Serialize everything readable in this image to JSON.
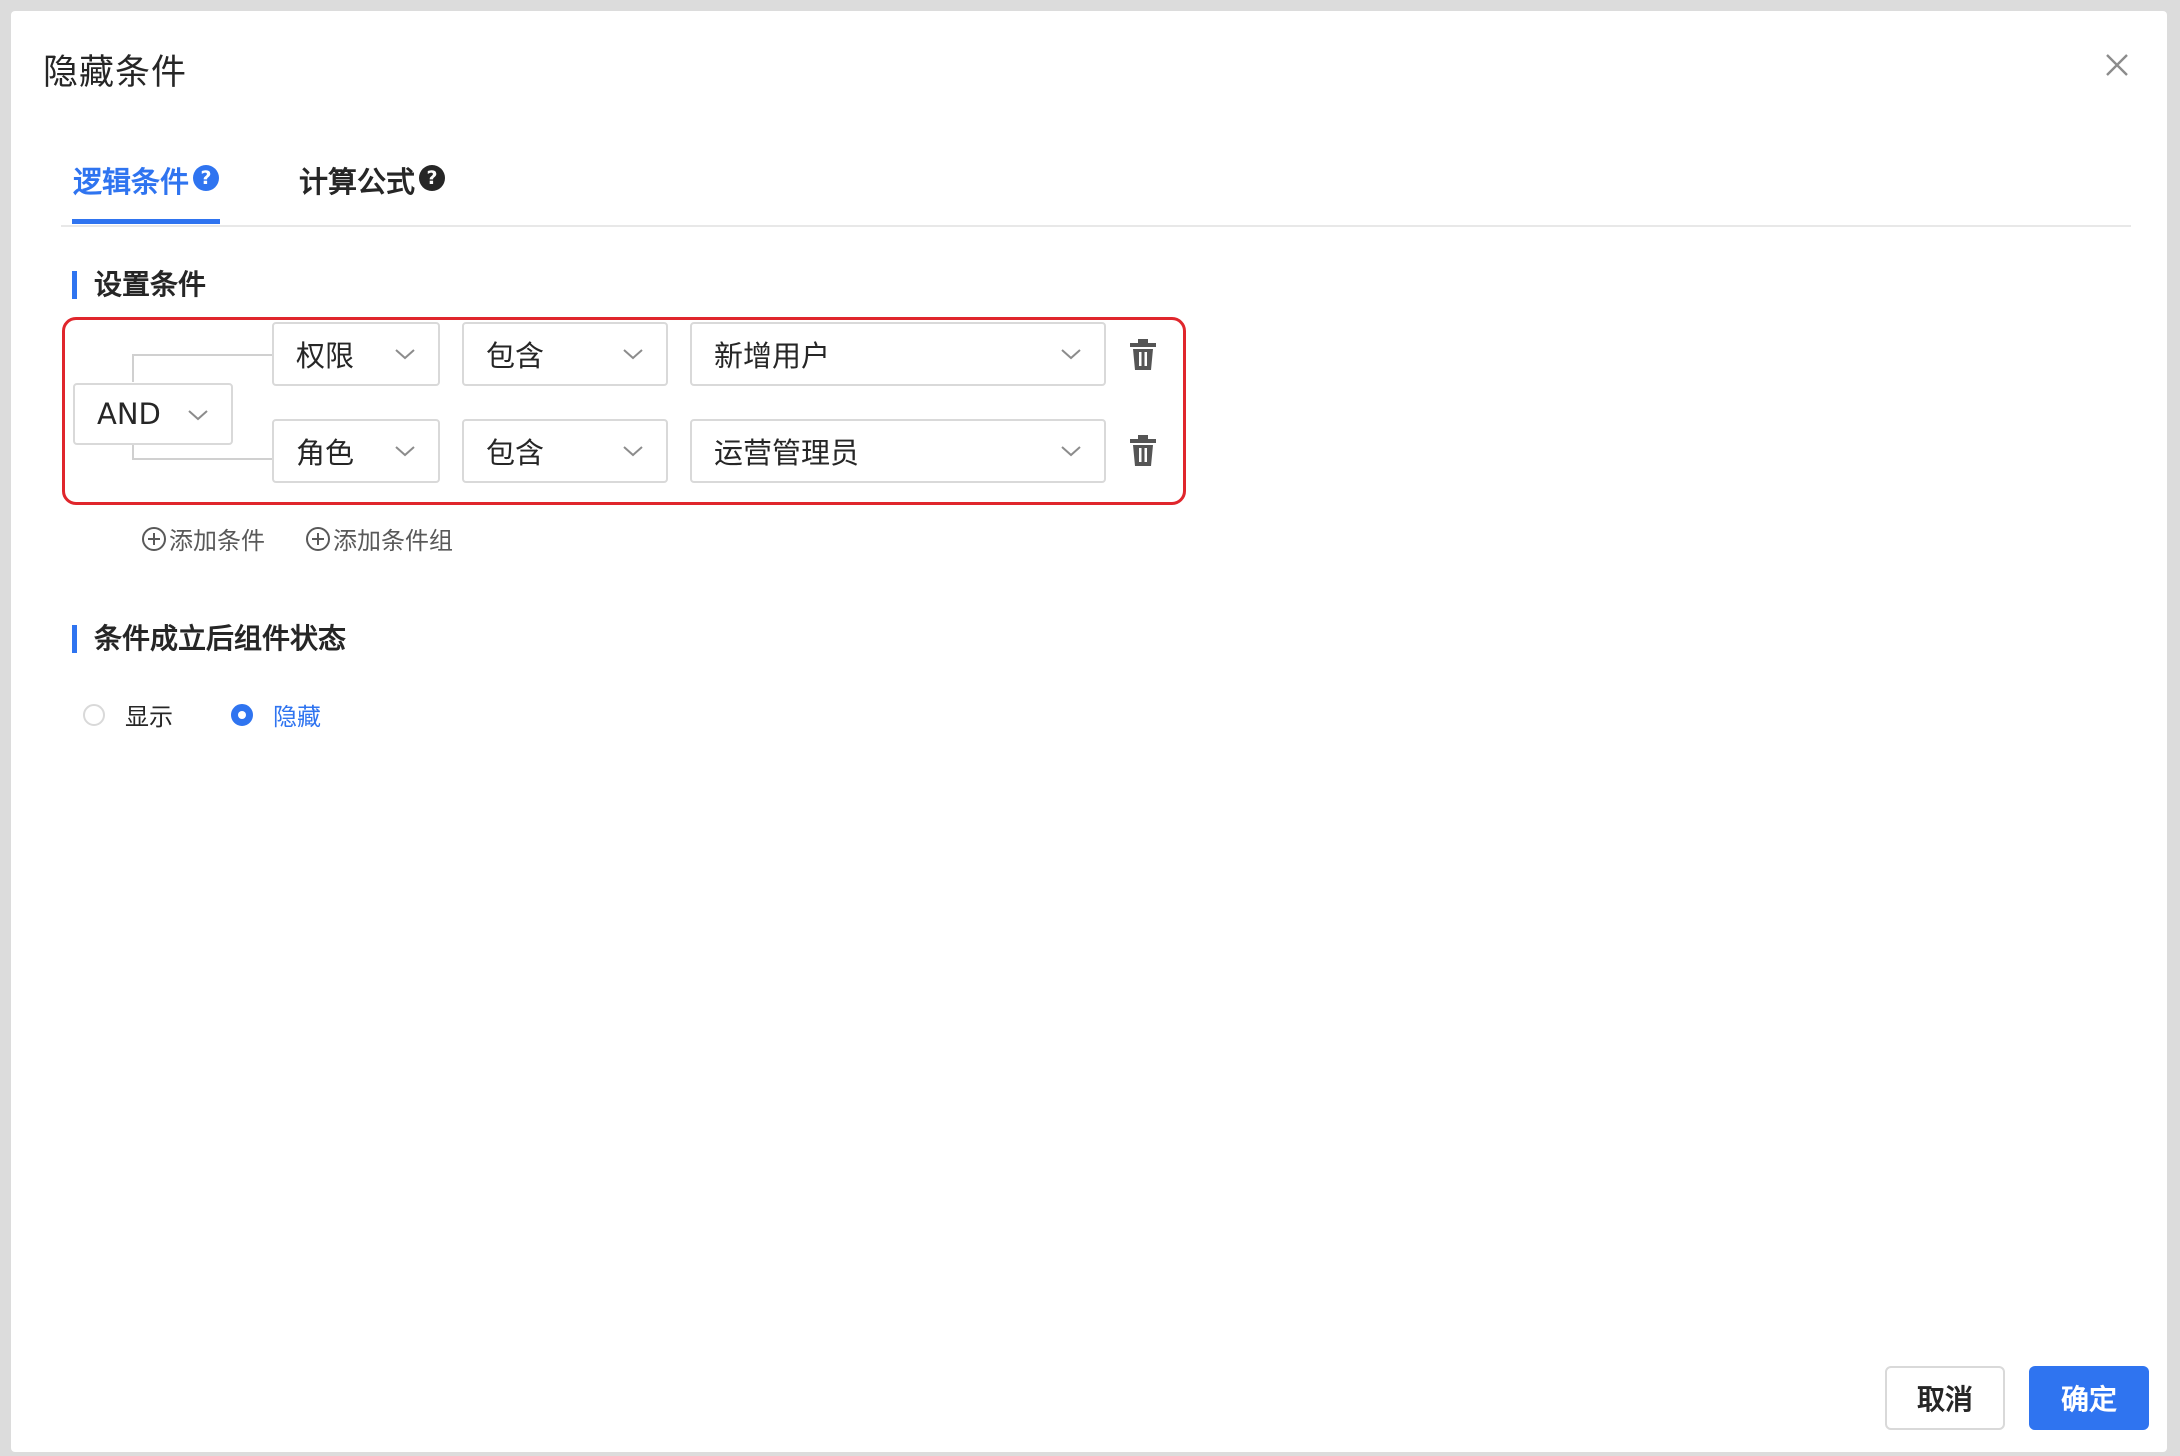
{
  "dialog": {
    "title": "隐藏条件",
    "close_icon": "close-icon"
  },
  "tabs": [
    {
      "label": "逻辑条件",
      "help": "?",
      "active": true
    },
    {
      "label": "计算公式",
      "help": "?",
      "active": false
    }
  ],
  "section_conditions": {
    "title": "设置条件"
  },
  "logic_operator": "AND",
  "conditions": [
    {
      "field": "权限",
      "operator": "包含",
      "value": "新增用户"
    },
    {
      "field": "角色",
      "operator": "包含",
      "value": "运营管理员"
    }
  ],
  "actions": {
    "add_condition": "添加条件",
    "add_condition_group": "添加条件组"
  },
  "section_state": {
    "title": "条件成立后组件状态"
  },
  "state_options": [
    {
      "label": "显示",
      "selected": false
    },
    {
      "label": "隐藏",
      "selected": true
    }
  ],
  "footer": {
    "cancel": "取消",
    "ok": "确定"
  },
  "colors": {
    "accent": "#2f74f0",
    "highlight_border": "#e0262c"
  }
}
